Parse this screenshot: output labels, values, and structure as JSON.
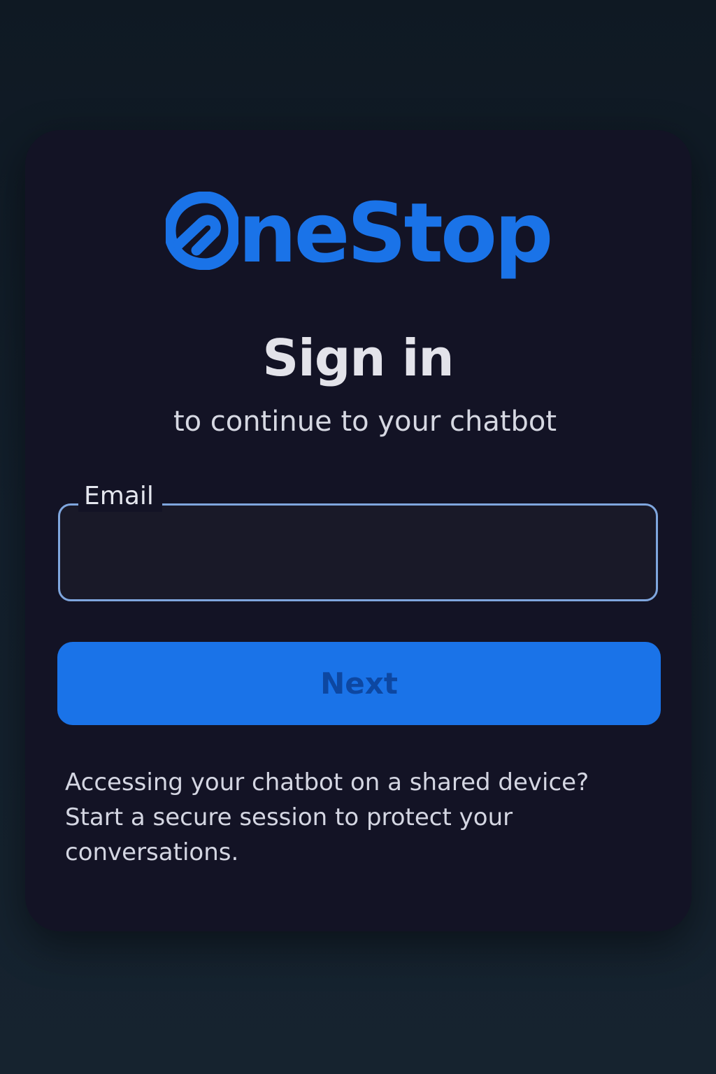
{
  "brand": {
    "logo_text": "neStop",
    "logo_mark": "O",
    "color": "#1a73e8"
  },
  "signin": {
    "title": "Sign in",
    "subtitle": "to continue to your chatbot"
  },
  "email_field": {
    "label": "Email",
    "value": "",
    "placeholder": ""
  },
  "next_button": {
    "label": "Next",
    "background": "#1a73e8",
    "text_color": "#0d47a1"
  },
  "help": {
    "text": "Accessing your chatbot on a shared device? Start a secure session to protect your conversations."
  },
  "colors": {
    "page_background": "#111c27",
    "card_background": "#131325",
    "field_border": "#7fa6de"
  }
}
